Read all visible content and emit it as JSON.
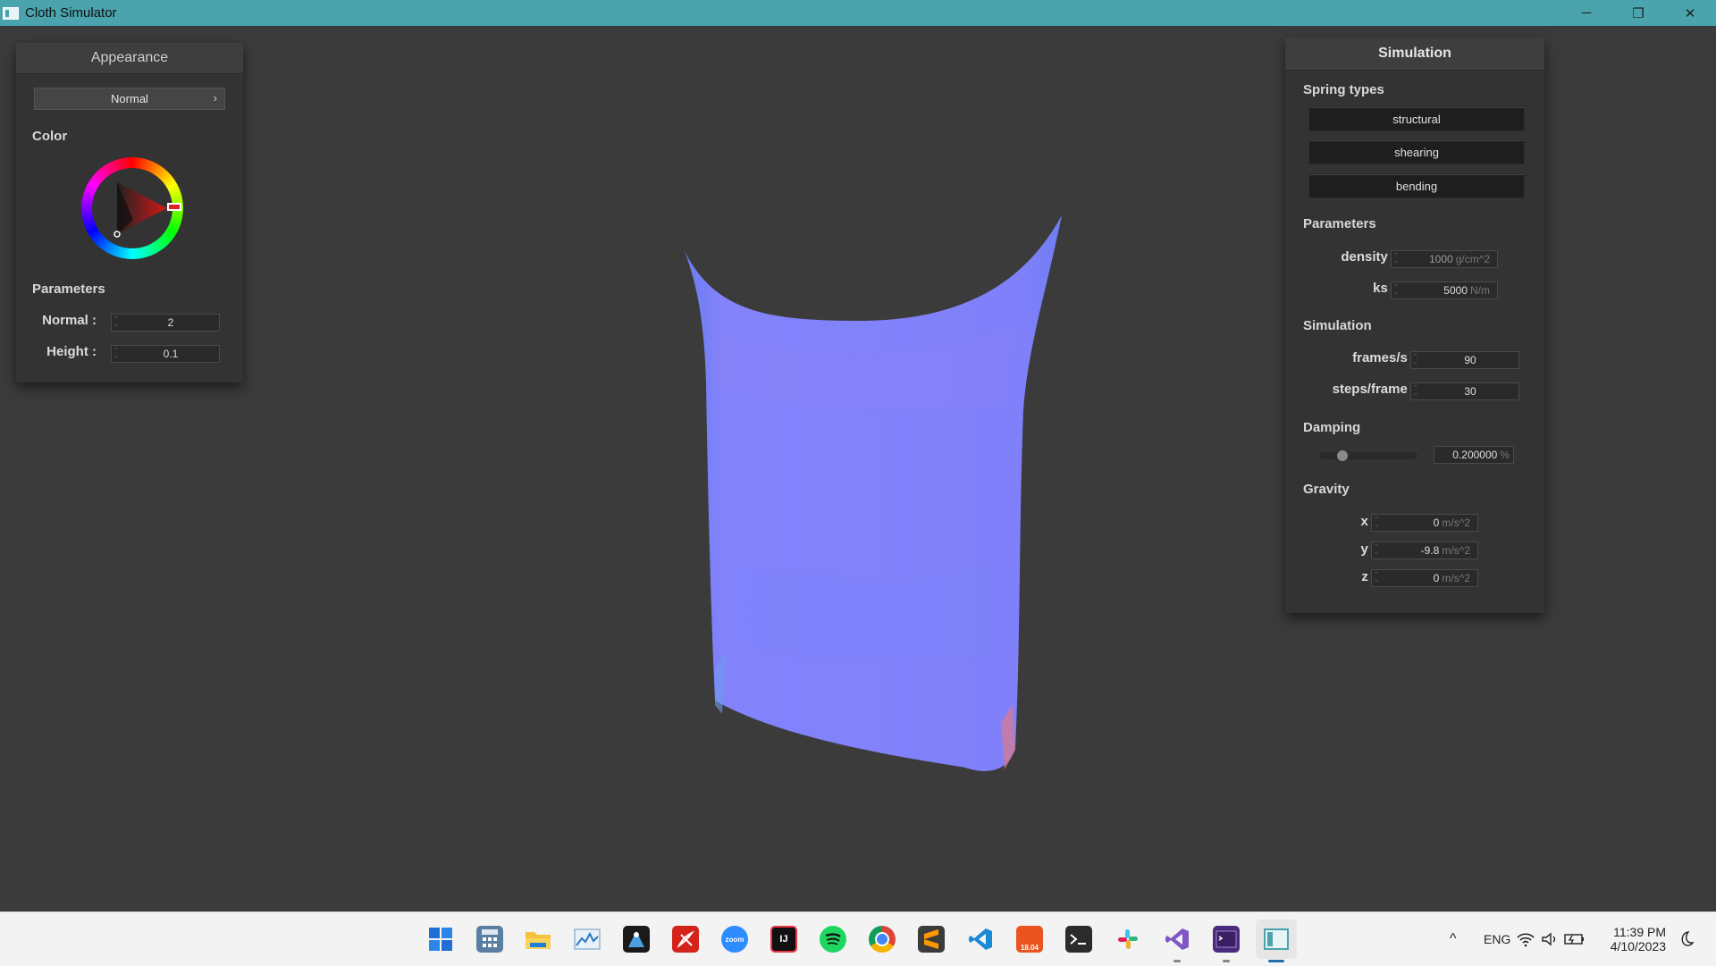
{
  "window": {
    "title": "Cloth Simulator",
    "controls": [
      "─",
      "❐",
      "✕"
    ]
  },
  "appearance": {
    "header": "Appearance",
    "mode_select": "Normal",
    "color_label": "Color",
    "color_value": "#c02020",
    "params_label": "Parameters",
    "normal_label": "Normal :",
    "normal_value": "2",
    "height_label": "Height :",
    "height_value": "0.1"
  },
  "simulation": {
    "header": "Simulation",
    "spring_types_label": "Spring types",
    "spring_buttons": [
      "structural",
      "shearing",
      "bending"
    ],
    "params_label": "Parameters",
    "density_label": "density :",
    "density_value": "1000",
    "density_unit": "g/cm^2",
    "ks_label": "ks :",
    "ks_value": "5000",
    "ks_unit": "N/m",
    "sim_label": "Simulation",
    "fps_label": "frames/s :",
    "fps_value": "90",
    "steps_label": "steps/frame :",
    "steps_value": "30",
    "damping_label": "Damping",
    "damping_value": "0.200000",
    "damping_unit": "%",
    "damping_level": 0.2,
    "gravity_label": "Gravity",
    "gx_label": "x :",
    "gx_value": "0",
    "gy_label": "y :",
    "gy_value": "-9.8",
    "gz_label": "z :",
    "gz_value": "0",
    "gravity_unit": "m/s^2"
  },
  "taskbar": {
    "apps": [
      "start-icon",
      "calculator-icon",
      "file-explorer-icon",
      "resource-monitor-icon",
      "reader-icon",
      "acrobat-icon",
      "zoom-icon",
      "intellij-icon",
      "spotify-icon",
      "chrome-icon",
      "sublime-icon",
      "vscode-icon",
      "ubuntu-icon",
      "terminal-icon",
      "slack-icon",
      "visual-studio-icon",
      "console-app-icon",
      "cloth-simulator-icon"
    ],
    "zoom_text": "zoom",
    "ij_text": "IJ",
    "ubuntu_text": "18.04",
    "tray_chevron": "^",
    "language": "ENG",
    "time": "11:39 PM",
    "date": "4/10/2023"
  },
  "colors": {
    "titlebar": "#4aa3ad",
    "viewport": "#3b3b3b",
    "panel": "#333333",
    "cloth": "#8080ff"
  }
}
